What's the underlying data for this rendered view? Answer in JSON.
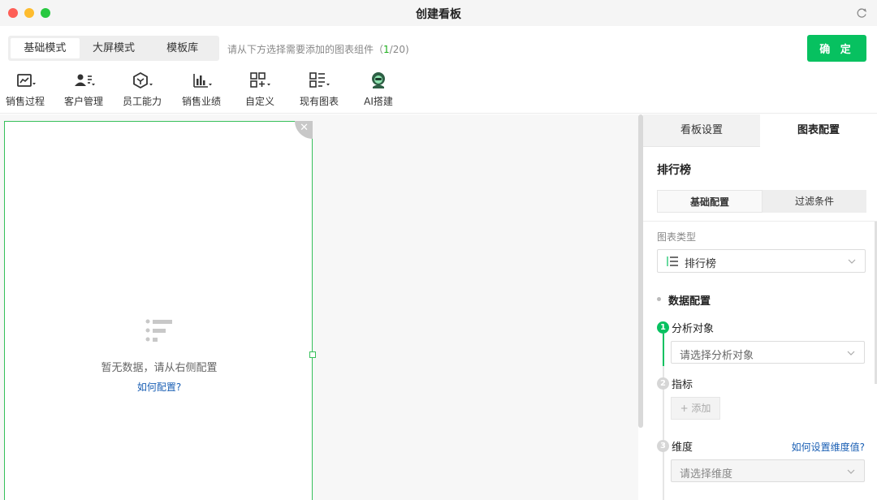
{
  "window": {
    "title": "创建看板"
  },
  "modes": {
    "tabs": [
      {
        "label": "基础模式",
        "active": true
      },
      {
        "label": "大屏模式",
        "active": false
      },
      {
        "label": "模板库",
        "active": false
      }
    ],
    "hint_prefix": "请从下方选择需要添加的图表组件（",
    "hint_count": "1",
    "hint_suffix": "/20)",
    "confirm_label": "确 定"
  },
  "toolbar": {
    "items": [
      {
        "label": "销售过程",
        "icon": "line-chart-icon"
      },
      {
        "label": "客户管理",
        "icon": "user-list-icon"
      },
      {
        "label": "员工能力",
        "icon": "hexagon-icon"
      },
      {
        "label": "销售业绩",
        "icon": "bar-chart-icon"
      },
      {
        "label": "自定义",
        "icon": "grid-add-icon"
      },
      {
        "label": "现有图表",
        "icon": "list-chart-icon"
      },
      {
        "label": "AI搭建",
        "icon": "ai-avatar-icon"
      }
    ]
  },
  "canvas": {
    "widget": {
      "close_glyph": "✕",
      "empty_text": "暂无数据，请从右侧配置",
      "help_link": "如何配置?"
    }
  },
  "panel": {
    "tabs": [
      {
        "label": "看板设置",
        "active": false
      },
      {
        "label": "图表配置",
        "active": true
      }
    ],
    "title": "排行榜",
    "subtabs": [
      {
        "label": "基础配置",
        "active": true
      },
      {
        "label": "过滤条件",
        "active": false
      }
    ],
    "chart_type_label": "图表类型",
    "chart_type_value": "排行榜",
    "data_section_title": "数据配置",
    "steps": [
      {
        "num": "1",
        "label": "分析对象",
        "placeholder": "请选择分析对象",
        "active": true
      },
      {
        "num": "2",
        "label": "指标",
        "add_label": "+ 添加",
        "active": false
      },
      {
        "num": "3",
        "label": "维度",
        "placeholder": "请选择维度",
        "help_link": "如何设置维度值?",
        "active": false
      }
    ]
  },
  "colors": {
    "accent": "#07c160",
    "link": "#1a5fb4",
    "widget_border": "#36c05a"
  }
}
